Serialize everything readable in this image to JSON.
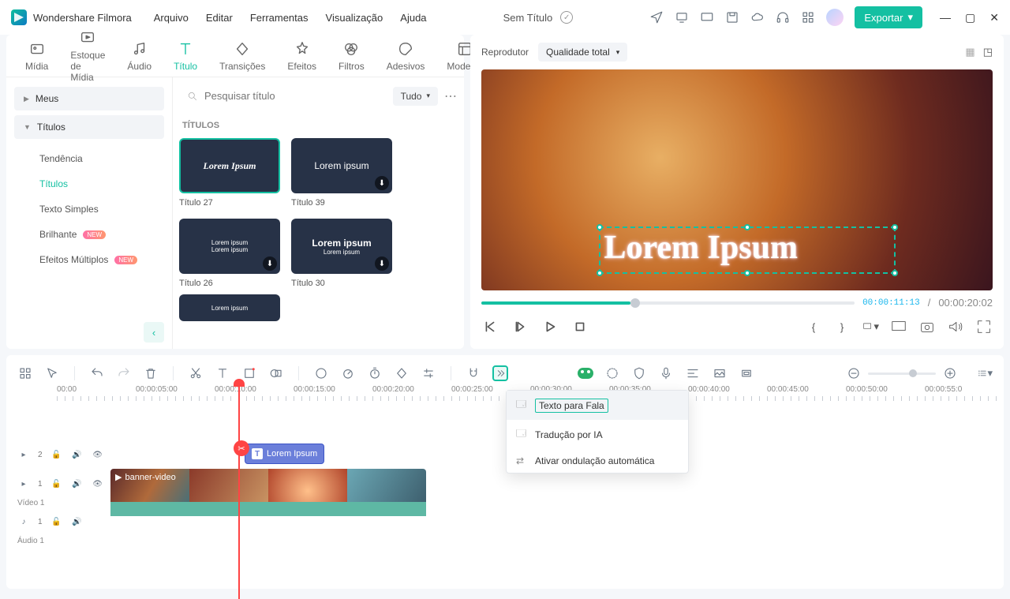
{
  "app": {
    "name": "Wondershare Filmora"
  },
  "menu": [
    "Arquivo",
    "Editar",
    "Ferramentas",
    "Visualização",
    "Ajuda"
  ],
  "doc_title": "Sem Título",
  "export_label": "Exportar",
  "tabs": [
    {
      "id": "media",
      "label": "Mídia"
    },
    {
      "id": "stock",
      "label": "Estoque de Mídia"
    },
    {
      "id": "audio",
      "label": "Áudio"
    },
    {
      "id": "titles",
      "label": "Título",
      "active": true
    },
    {
      "id": "transitions",
      "label": "Transições"
    },
    {
      "id": "effects",
      "label": "Efeitos"
    },
    {
      "id": "filters",
      "label": "Filtros"
    },
    {
      "id": "stickers",
      "label": "Adesivos"
    },
    {
      "id": "templates",
      "label": "Modelos"
    }
  ],
  "sidebar": {
    "meus": "Meus",
    "titulos": "Títulos",
    "items": [
      {
        "label": "Tendência"
      },
      {
        "label": "Títulos",
        "active": true
      },
      {
        "label": "Texto Simples"
      },
      {
        "label": "Brilhante",
        "badge": "NEW"
      },
      {
        "label": "Efeitos Múltiplos",
        "badge": "NEW"
      }
    ]
  },
  "search": {
    "placeholder": "Pesquisar título"
  },
  "filter": {
    "label": "Tudo"
  },
  "assets": {
    "heading": "TÍTULOS",
    "items": [
      {
        "text": "Lorem Ipsum",
        "label": "Título 27",
        "cursive": true,
        "selected": true
      },
      {
        "text": "Lorem ipsum",
        "label": "Título 39",
        "dl": true
      },
      {
        "text": "Lorem ipsum",
        "sub": "Lorem ipsum",
        "label": "Título 26",
        "dl": true,
        "small": true
      },
      {
        "text": "Lorem ipsum",
        "sub": "Lorem ipsum",
        "label": "Título 30",
        "dl": true
      },
      {
        "text": "Lorem ipsum",
        "label": "",
        "small": true
      }
    ]
  },
  "preview": {
    "reproducer": "Reprodutor",
    "quality": "Qualidade total",
    "overlay": "Lorem Ipsum",
    "cur": "00:00:11:13",
    "total": "00:00:20:02"
  },
  "context_menu": {
    "tts": "Texto para Fala",
    "translate": "Tradução por IA",
    "ripple": "Ativar ondulação automática"
  },
  "ruler": [
    "00:00",
    "00:00:05:00",
    "00:00:10:00",
    "00:00:15:00",
    "00:00:20:00",
    "00:00:25:00",
    "00:00:30:00",
    "00:00:35:00",
    "00:00:40:00",
    "00:00:45:00",
    "00:00:50:00",
    "00:00:55:0"
  ],
  "tracks": {
    "t2": "2",
    "t1": "1",
    "video_label": "Vídeo 1",
    "audio_label": "Áudio 1",
    "title_clip": "Lorem Ipsum",
    "video_clip": "banner-video"
  }
}
